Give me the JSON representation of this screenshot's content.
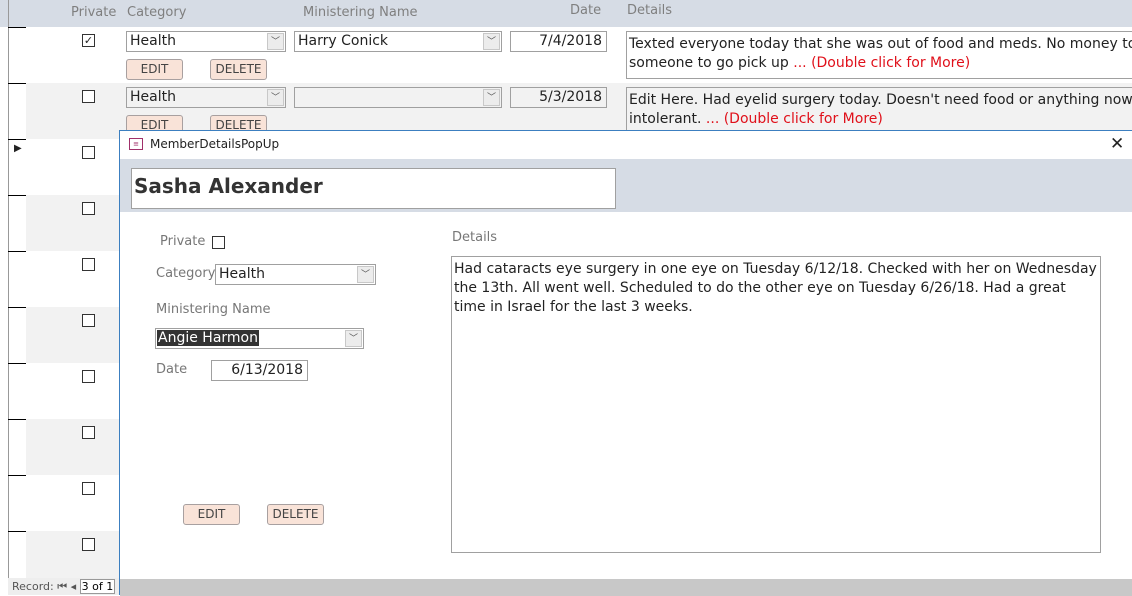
{
  "grid": {
    "headers": {
      "private": "Private",
      "category": "Category",
      "ministering_name": "Ministering Name",
      "date": "Date",
      "details": "Details"
    },
    "rows": [
      {
        "private": true,
        "category": "Health",
        "ministering_name": "Harry Conick",
        "date": "7/4/2018",
        "details_line1": "Texted everyone today that she was out of food and meds.  No money to buy a",
        "details_line2": "someone to go pick up ",
        "more": "... (Double click for More)",
        "edit": "EDIT",
        "delete": "DELETE"
      },
      {
        "private": false,
        "category": "Health",
        "ministering_name": "",
        "date": "5/3/2018",
        "details_line1": "Edit Here.  Had eyelid surgery today.  Doesn't need food or anything now.  She",
        "details_line2": "intolerant.  ",
        "more": "... (Double click for More)",
        "edit": "EDIT",
        "delete": "DELETE"
      }
    ],
    "current_record_index": 3
  },
  "record_nav": {
    "label": "Record:",
    "position": "3 of 1"
  },
  "popup": {
    "title": "MemberDetailsPopUp",
    "member_name": "Sasha Alexander",
    "private_label": "Private",
    "private": false,
    "category_label": "Category",
    "category": "Health",
    "ministering_label": "Ministering Name",
    "ministering_name": "Angie Harmon",
    "date_label": "Date",
    "date": "6/13/2018",
    "details_label": "Details",
    "details": "Had cataracts eye surgery in one eye on Tuesday 6/12/18.  Checked with her on Wednesday the 13th.  All went well.  Scheduled to do the other eye on Tuesday 6/26/18.  Had a great time in Israel for the last 3 weeks.",
    "edit": "EDIT",
    "delete": "DELETE"
  },
  "colors": {
    "header_band": "#d6dce5",
    "button": "#f9e3d8",
    "more_link": "#e0101a"
  }
}
